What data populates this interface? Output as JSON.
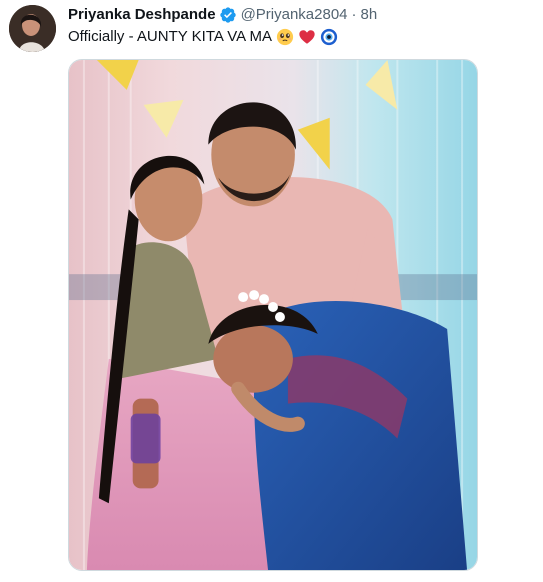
{
  "tweet": {
    "author_name": "Priyanka Deshpande",
    "handle": "@Priyanka2804",
    "separator": "·",
    "time": "8h",
    "text": "Officially - AUNTY KITA VA MA",
    "emojis": [
      "pleading-face-emoji",
      "red-heart-emoji",
      "nazar-amulet-emoji"
    ],
    "verified": true
  },
  "colors": {
    "verified_badge": "#1d9bf0",
    "secondary_text": "#536471",
    "primary_text": "#0f1419"
  },
  "media": {
    "type": "photo"
  }
}
